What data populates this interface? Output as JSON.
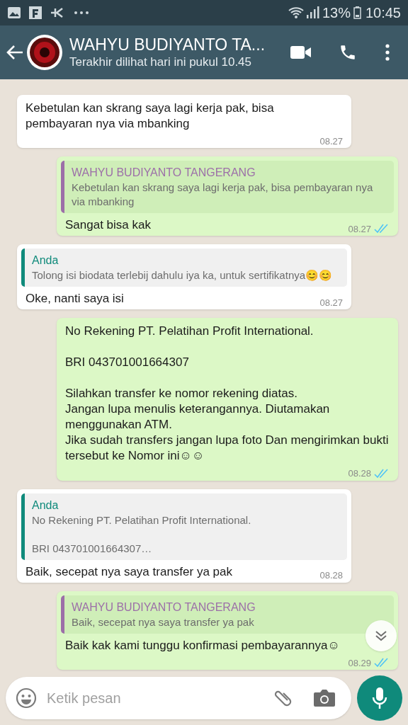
{
  "status_bar": {
    "time": "10:45",
    "battery": "13%"
  },
  "header": {
    "title": "WAHYU BUDIYANTO TA...",
    "subtitle": "Terakhir dilihat hari ini pukul 10.45"
  },
  "messages": [
    {
      "kind": "in",
      "text": "Kebetulan kan skrang saya lagi kerja pak, bisa pembayaran nya via mbanking",
      "time": "08.27"
    },
    {
      "kind": "out",
      "quote": {
        "author": "WAHYU BUDIYANTO TANGERANG",
        "color": "#9c6fa8",
        "text": "Kebetulan kan skrang saya lagi kerja pak, bisa pembayaran nya via mbanking"
      },
      "text": "Sangat bisa kak",
      "time": "08.27",
      "read": true
    },
    {
      "kind": "in",
      "quote": {
        "author": "Anda",
        "color": "#0f8a7b",
        "text": "Tolong isi biodata terlebij dahulu iya ka, untuk sertifikatnya😊😊"
      },
      "text": "Oke, nanti saya isi",
      "time": "08.27"
    },
    {
      "kind": "out",
      "text": "No Rekening PT. Pelatihan Profit International.\n\nBRI 043701001664307\n\nSilahkan transfer ke nomor rekening diatas.\nJangan lupa menulis keterangannya. Diutamakan menggunakan ATM.\nJika sudah transfers jangan lupa foto Dan mengirimkan bukti tersebut ke Nomor ini☺☺",
      "time": "08.28",
      "read": true
    },
    {
      "kind": "in",
      "quote": {
        "author": "Anda",
        "color": "#0f8a7b",
        "text": "No Rekening PT. Pelatihan Profit International.\n\nBRI 043701001664307…"
      },
      "text": "Baik, secepat nya saya transfer ya pak",
      "time": "08.28"
    },
    {
      "kind": "out",
      "quote": {
        "author": "WAHYU BUDIYANTO TANGERANG",
        "color": "#9c6fa8",
        "text": "Baik, secepat nya saya transfer ya pak"
      },
      "text": "Baik kak kami tunggu konfirmasi pembayarannya☺",
      "time": "08.29",
      "read": true
    }
  ],
  "composer": {
    "placeholder": "Ketik pesan"
  }
}
